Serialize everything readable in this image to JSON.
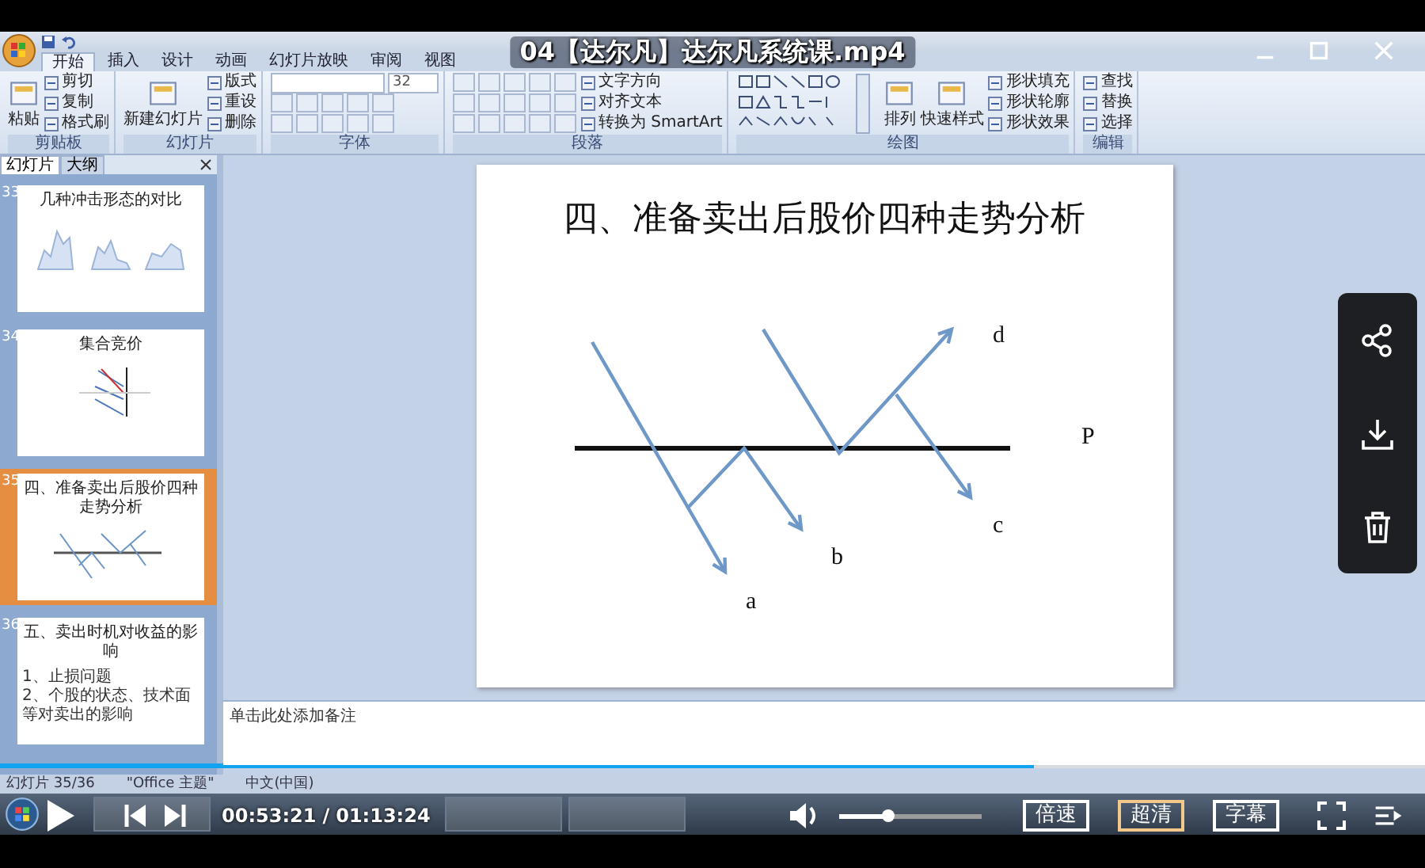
{
  "player": {
    "title": "04【达尔凡】达尔凡系统课.mp4",
    "current_time": "00:53:21",
    "time_separator": "/",
    "duration": "01:13:24",
    "progress": {
      "level": 0.725
    },
    "volume": {
      "level": 0.34
    },
    "buttons": [
      {
        "label": "倍速",
        "selected": false
      },
      {
        "label": "超清",
        "selected": true
      },
      {
        "label": "字幕",
        "selected": false
      }
    ]
  },
  "ppt": {
    "ribbon_tabs": [
      {
        "label": "开始",
        "selected": true
      },
      {
        "label": "插入",
        "selected": false
      },
      {
        "label": "设计",
        "selected": false
      },
      {
        "label": "动画",
        "selected": false
      },
      {
        "label": "幻灯片放映",
        "selected": false
      },
      {
        "label": "审阅",
        "selected": false
      },
      {
        "label": "视图",
        "selected": false
      }
    ],
    "groups": [
      {
        "name": "剪贴板",
        "items": [
          {
            "kind": "large",
            "label": "粘贴"
          },
          {
            "kind": "small",
            "label": "剪切"
          },
          {
            "kind": "small",
            "label": "复制"
          },
          {
            "kind": "small",
            "label": "格式刷"
          }
        ]
      },
      {
        "name": "幻灯片",
        "items": [
          {
            "kind": "large",
            "label": "新建幻灯片"
          },
          {
            "kind": "small",
            "label": "版式"
          },
          {
            "kind": "small",
            "label": "重设"
          },
          {
            "kind": "small",
            "label": "删除"
          }
        ]
      },
      {
        "name": "字体",
        "items": [
          {
            "kind": "font",
            "label": "32"
          },
          {
            "kind": "tools"
          },
          {
            "kind": "tools"
          }
        ]
      },
      {
        "name": "段落",
        "items": [
          {
            "kind": "tools"
          },
          {
            "kind": "tools"
          },
          {
            "kind": "tools"
          },
          {
            "kind": "small",
            "label": "文字方向"
          },
          {
            "kind": "small",
            "label": "对齐文本"
          },
          {
            "kind": "small",
            "label": "转换为 SmartArt"
          }
        ]
      },
      {
        "name": "绘图",
        "items": [
          {
            "kind": "shapes"
          },
          {
            "kind": "large",
            "label": "排列"
          },
          {
            "kind": "large",
            "label": "快速样式"
          },
          {
            "kind": "small",
            "label": "形状填充"
          },
          {
            "kind": "small",
            "label": "形状轮廓"
          },
          {
            "kind": "small",
            "label": "形状效果"
          }
        ]
      },
      {
        "name": "编辑",
        "items": [
          {
            "kind": "small",
            "label": "查找"
          },
          {
            "kind": "small",
            "label": "替换"
          },
          {
            "kind": "small",
            "label": "选择"
          }
        ]
      }
    ],
    "pane_tabs": [
      {
        "label": "幻灯片",
        "selected": true
      },
      {
        "label": "大纲",
        "selected": false
      }
    ],
    "slides": [
      {
        "number": "33",
        "title": "几种冲击形态的对比",
        "kind": "charts",
        "selected": false
      },
      {
        "number": "34",
        "title": "集合竞价",
        "kind": "lines",
        "selected": false
      },
      {
        "number": "35",
        "title": "四、准备卖出后股价四种走势分析",
        "kind": "trend",
        "selected": true
      },
      {
        "number": "36",
        "title": "五、卖出时机对收益的影响",
        "kind": "text",
        "bullets": [
          "1、止损问题",
          "2、个股的状态、技术面等对卖出的影响"
        ],
        "selected": false
      }
    ],
    "slide": {
      "title": "四、准备卖出后股价四种走势分析",
      "labels": [
        {
          "text": "a",
          "kind": "a"
        },
        {
          "text": "b",
          "kind": "b"
        },
        {
          "text": "c",
          "kind": "c"
        },
        {
          "text": "d",
          "kind": "d"
        },
        {
          "text": "P",
          "kind": "p"
        }
      ]
    },
    "notes": "单击此处添加备注",
    "status_bar": [
      "幻灯片 35/36",
      "\"Office 主题\"",
      "中文(中国)"
    ]
  }
}
